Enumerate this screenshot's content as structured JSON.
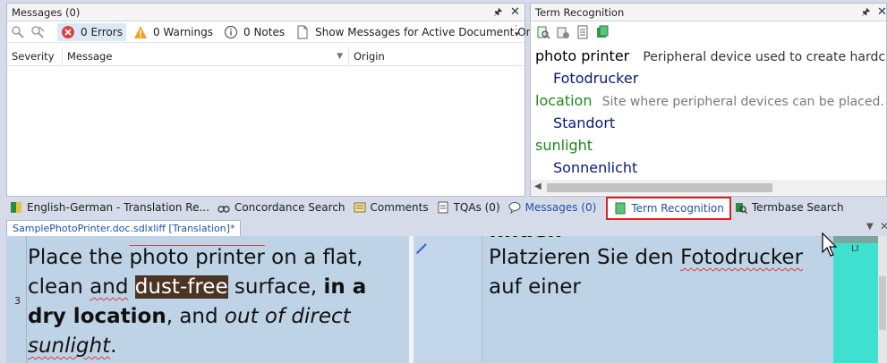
{
  "messages_panel": {
    "title": "Messages (0)",
    "toolbar": {
      "errors": "0 Errors",
      "warnings": "0 Warnings",
      "notes": "0 Notes",
      "show_active": "Show Messages for Active Document Only"
    },
    "columns": [
      "Severity",
      "Message",
      "Origin"
    ]
  },
  "term_panel": {
    "title": "Term Recognition",
    "entries": [
      {
        "source": "photo printer",
        "description": "Peripheral device used to create hardco",
        "target": "Fotodrucker"
      },
      {
        "source": "location",
        "description": "Site where peripheral devices can be placed.",
        "target": "Standort"
      },
      {
        "source": "sunlight",
        "description": "",
        "target": "Sonnenlicht"
      }
    ]
  },
  "tabs": [
    {
      "label": "English-German - Translation Re..."
    },
    {
      "label": "Concordance Search"
    },
    {
      "label": "Comments"
    },
    {
      "label": "TQAs (0)"
    },
    {
      "label": "Messages (0)"
    },
    {
      "label": "Term Recognition"
    },
    {
      "label": "Termbase Search"
    }
  ],
  "document_tab": "SamplePhotoPrinter.doc.sdlxliff [Translation]*",
  "editor": {
    "segment_number": "3",
    "source": {
      "p1": "Place the ",
      "term1": "photo printer",
      "p2": " on a flat, clean ",
      "and": "and",
      "p3": " ",
      "highlight": "dust-free",
      "p4": " surface, ",
      "bold": "in a dry location",
      "p5": ", and ",
      "italic": "out of direct ",
      "sunlight": "sunlight",
      "p6": "."
    },
    "prev_target_fragment": "finden",
    "target": {
      "p1": "Platzieren Sie den ",
      "term": "Fotodrucker",
      "p2": " auf einer"
    },
    "status_label": "LI"
  },
  "colors": {
    "term_source": "#000000",
    "term_green": "#1a8a1a",
    "term_target": "#0a1a78",
    "highlight_box": "#e02020",
    "status_bar": "#40e0d0"
  }
}
